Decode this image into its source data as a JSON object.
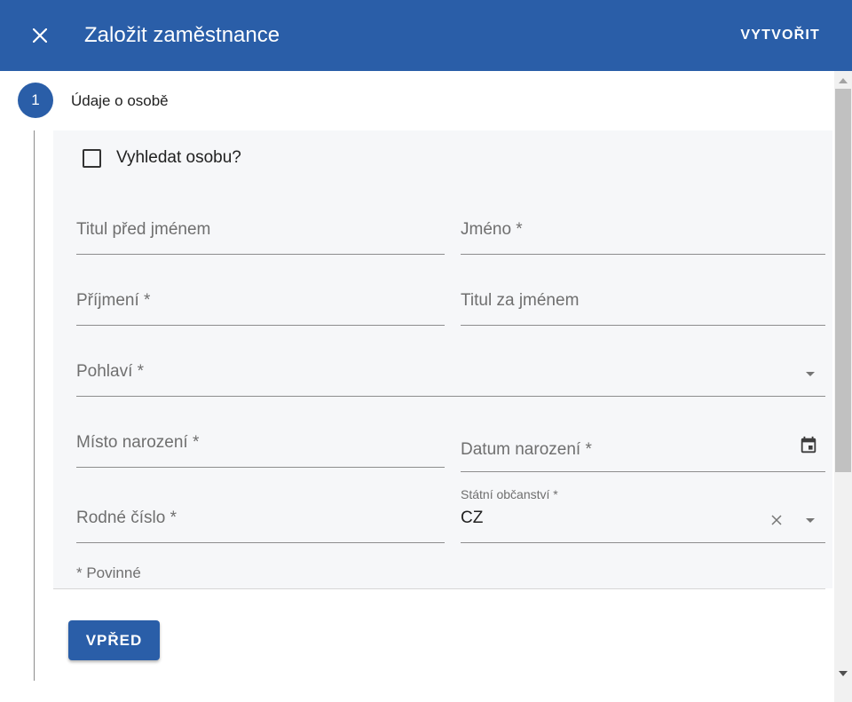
{
  "dialog": {
    "title": "Založit zaměstnance",
    "create_label": "VYTVOŘIT",
    "close_icon": "close-icon"
  },
  "stepper": {
    "step_number": "1",
    "step_label": "Údaje o osobě"
  },
  "form": {
    "search_person": {
      "label": "Vyhledat osobu?",
      "checked": false
    },
    "title_before": {
      "label": "Titul před jménem",
      "value": ""
    },
    "first_name": {
      "label": "Jméno *",
      "value": ""
    },
    "last_name": {
      "label": "Příjmení *",
      "value": ""
    },
    "title_after": {
      "label": "Titul za jménem",
      "value": ""
    },
    "gender": {
      "label": "Pohlaví *",
      "value": ""
    },
    "birth_place": {
      "label": "Místo narození *",
      "value": ""
    },
    "birth_date": {
      "label": "Datum narození *",
      "value": "",
      "icon": "calendar-icon"
    },
    "birth_number": {
      "label": "Rodné číslo *",
      "value": ""
    },
    "citizenship": {
      "label": "Státní občanství *",
      "value": "CZ"
    },
    "required_hint": "* Povinné"
  },
  "actions": {
    "next_label": "VPŘED"
  },
  "colors": {
    "primary": "#2a5ea8",
    "panel_background": "#f6f7f9"
  }
}
